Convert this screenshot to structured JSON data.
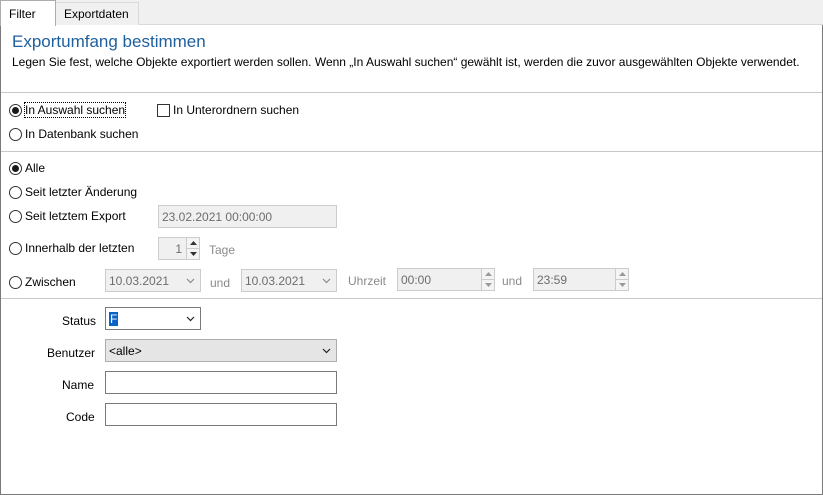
{
  "tabs": [
    {
      "label": "Filter",
      "active": true
    },
    {
      "label": "Exportdaten",
      "active": false
    }
  ],
  "header": {
    "title": "Exportumfang bestimmen",
    "description": "Legen Sie fest, welche Objekte exportiert werden sollen. Wenn „In Auswahl suchen“ gewählt ist, werden die zuvor ausgewählten Objekte verwendet."
  },
  "scope": {
    "in_selection_label": "In Auswahl suchen",
    "in_selection_checked": true,
    "in_subfolders_label": "In Unterordnern suchen",
    "in_subfolders_checked": false,
    "in_database_label": "In Datenbank suchen",
    "in_database_checked": false
  },
  "period": {
    "all_label": "Alle",
    "since_change_label": "Seit letzter Änderung",
    "since_export_label": "Seit letztem Export",
    "since_export_value": "23.02.2021 00:00:00",
    "within_last_label": "Innerhalb der letzten",
    "within_last_value": "1",
    "within_last_unit": "Tage",
    "between_label": "Zwischen",
    "from_date": "10.03.2021",
    "and_label": "und",
    "to_date": "10.03.2021",
    "time_label": "Uhrzeit",
    "from_time": "00:00",
    "and_label_2": "und",
    "to_time": "23:59",
    "selected": "all"
  },
  "filters": {
    "status_label": "Status",
    "status_value": "F",
    "user_label": "Benutzer",
    "user_value": "<alle>",
    "name_label": "Name",
    "name_value": "",
    "code_label": "Code",
    "code_value": ""
  },
  "colors": {
    "title": "#1e5f9e",
    "selection": "#0a64c8"
  }
}
